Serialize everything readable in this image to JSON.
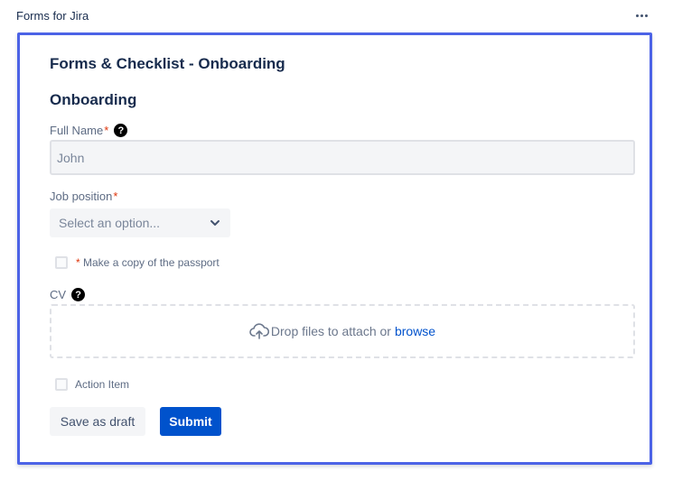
{
  "app": {
    "title": "Forms for Jira"
  },
  "form": {
    "title": "Forms & Checklist - Onboarding",
    "section_title": "Onboarding",
    "full_name": {
      "label": "Full Name",
      "required_mark": "*",
      "placeholder": "John"
    },
    "job_position": {
      "label": "Job position",
      "required_mark": "*",
      "select_value": "Select an option..."
    },
    "passport_checkbox": {
      "required_mark": "*",
      "label": "Make a copy of the passport"
    },
    "cv": {
      "label": "CV",
      "dropzone_text": "Drop files to attach or",
      "browse_label": "browse"
    },
    "action_item": {
      "label": "Action Item"
    },
    "buttons": {
      "save_draft": "Save as draft",
      "submit": "Submit"
    }
  },
  "icons": {
    "more": "more-horizontal-icon",
    "help": "question-circle-icon",
    "chevron": "chevron-down-icon",
    "upload": "cloud-upload-icon"
  },
  "colors": {
    "accent": "#0052cc",
    "frame": "#4c63e6",
    "required": "#de350b"
  }
}
